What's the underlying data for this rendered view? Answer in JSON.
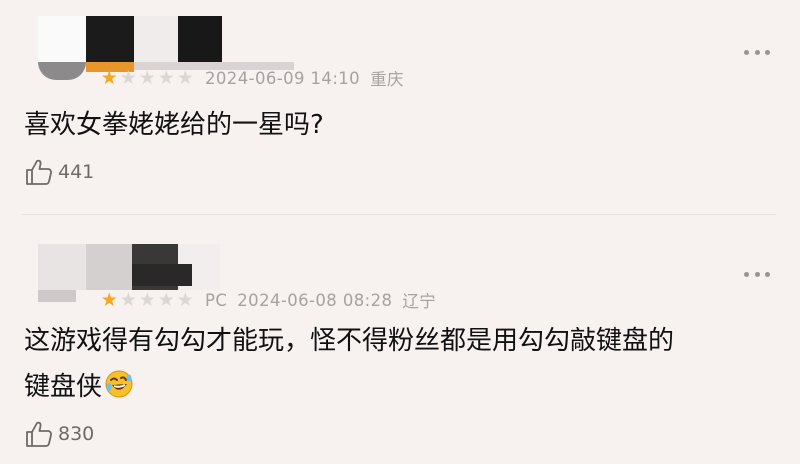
{
  "comments": [
    {
      "rating": 1,
      "max_rating": 5,
      "date": "2024-06-09 14:10",
      "location": "重庆",
      "text": "喜欢女拳姥姥给的一星吗?",
      "likes": "441"
    },
    {
      "rating": 1,
      "max_rating": 5,
      "platform": "PC",
      "date": "2024-06-08 08:28",
      "location": "辽宁",
      "text_line1": "这游戏得有勾勾才能玩，怪不得粉丝都是用勾勾敲键盘的",
      "text_line2": "键盘侠",
      "emoji": "rolling-on-floor-laughing",
      "likes": "830"
    }
  ],
  "colors": {
    "star_active": "#f5a623",
    "star_inactive": "#dcd6d5",
    "background": "#f7f1f0",
    "meta_text": "#a7a2a1"
  }
}
